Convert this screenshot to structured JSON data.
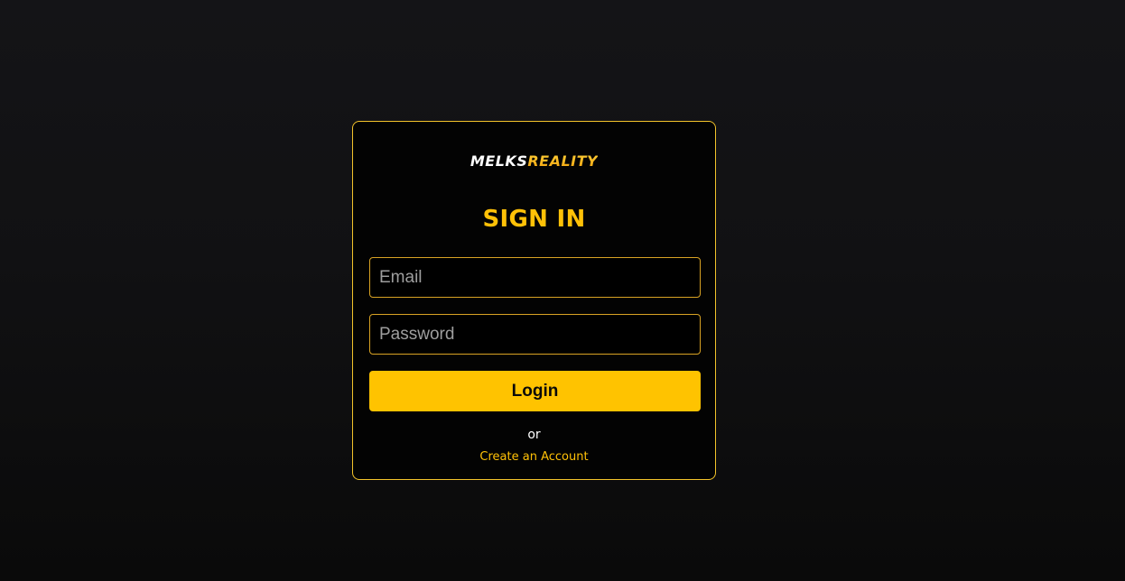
{
  "colors": {
    "accent": "#ffc300",
    "title": "#ffc107",
    "border": "#f3c32a",
    "card_bg": "#030303",
    "page_bg": "#141417"
  },
  "logo": {
    "part1": "MELKS",
    "part2": "REALITY"
  },
  "form": {
    "title": "SIGN IN",
    "email": {
      "placeholder": "Email",
      "value": ""
    },
    "password": {
      "placeholder": "Password",
      "value": ""
    },
    "login_label": "Login",
    "or_text": "or",
    "create_account_label": "Create an Account"
  }
}
